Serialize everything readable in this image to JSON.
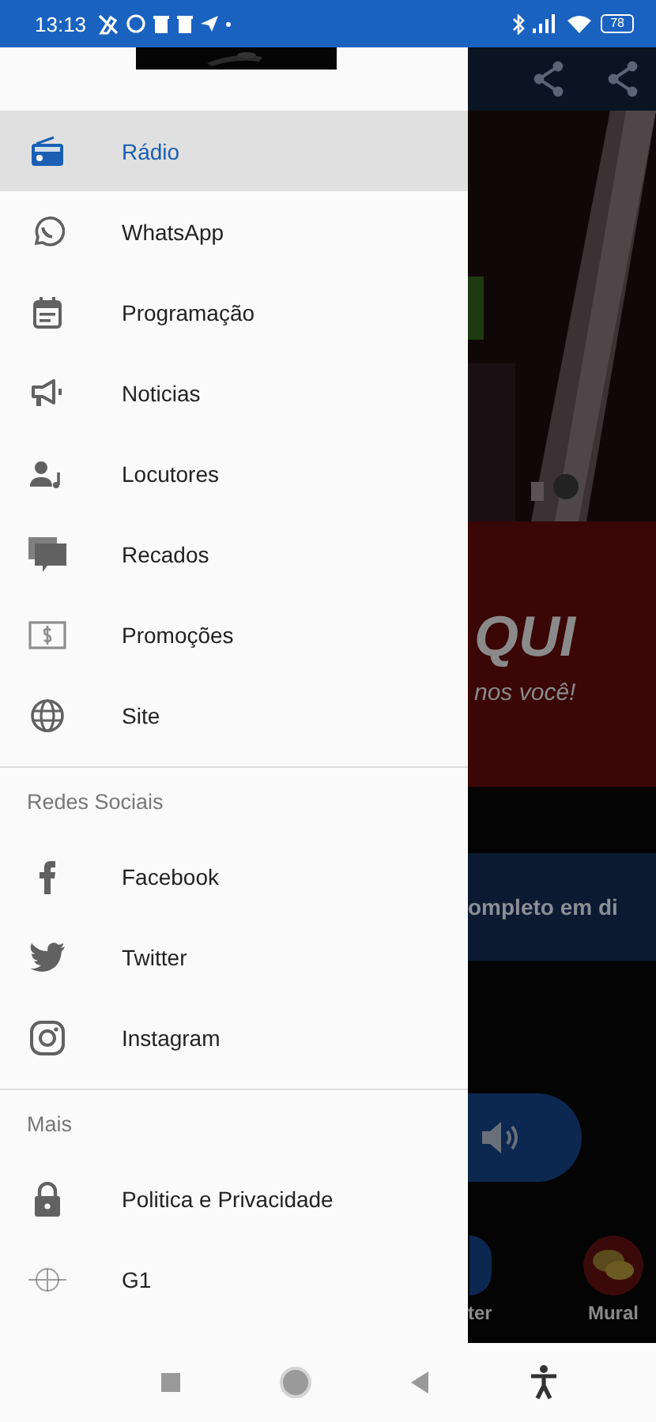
{
  "status_bar": {
    "time": "13:13",
    "battery": "78"
  },
  "drawer": {
    "sections": [
      {
        "items": [
          {
            "kind": "radio",
            "label": "Rádio",
            "selected": true
          },
          {
            "kind": "whatsapp",
            "label": "WhatsApp",
            "selected": false
          },
          {
            "kind": "calendar",
            "label": "Programação",
            "selected": false
          },
          {
            "kind": "megaphone",
            "label": "Noticias",
            "selected": false
          },
          {
            "kind": "person-music",
            "label": "Locutores",
            "selected": false
          },
          {
            "kind": "chat",
            "label": "Recados",
            "selected": false
          },
          {
            "kind": "money",
            "label": "Promoções",
            "selected": false
          },
          {
            "kind": "globe",
            "label": "Site",
            "selected": false
          }
        ]
      },
      {
        "header": "Redes Sociais",
        "items": [
          {
            "kind": "facebook",
            "label": "Facebook",
            "selected": false
          },
          {
            "kind": "twitter",
            "label": "Twitter",
            "selected": false
          },
          {
            "kind": "instagram",
            "label": "Instagram",
            "selected": false
          }
        ]
      },
      {
        "header": "Mais",
        "items": [
          {
            "kind": "lock",
            "label": "Politica e Privacidade",
            "selected": false
          },
          {
            "kind": "news",
            "label": "G1",
            "selected": false
          }
        ]
      }
    ]
  },
  "background_app": {
    "banner_title": "QUI",
    "banner_subtitle": "nos você!",
    "info_text": "ompleto em di",
    "bottom_buttons": [
      {
        "kind": "twitter",
        "label": "ter"
      },
      {
        "kind": "mural",
        "label": "Mural"
      }
    ]
  }
}
